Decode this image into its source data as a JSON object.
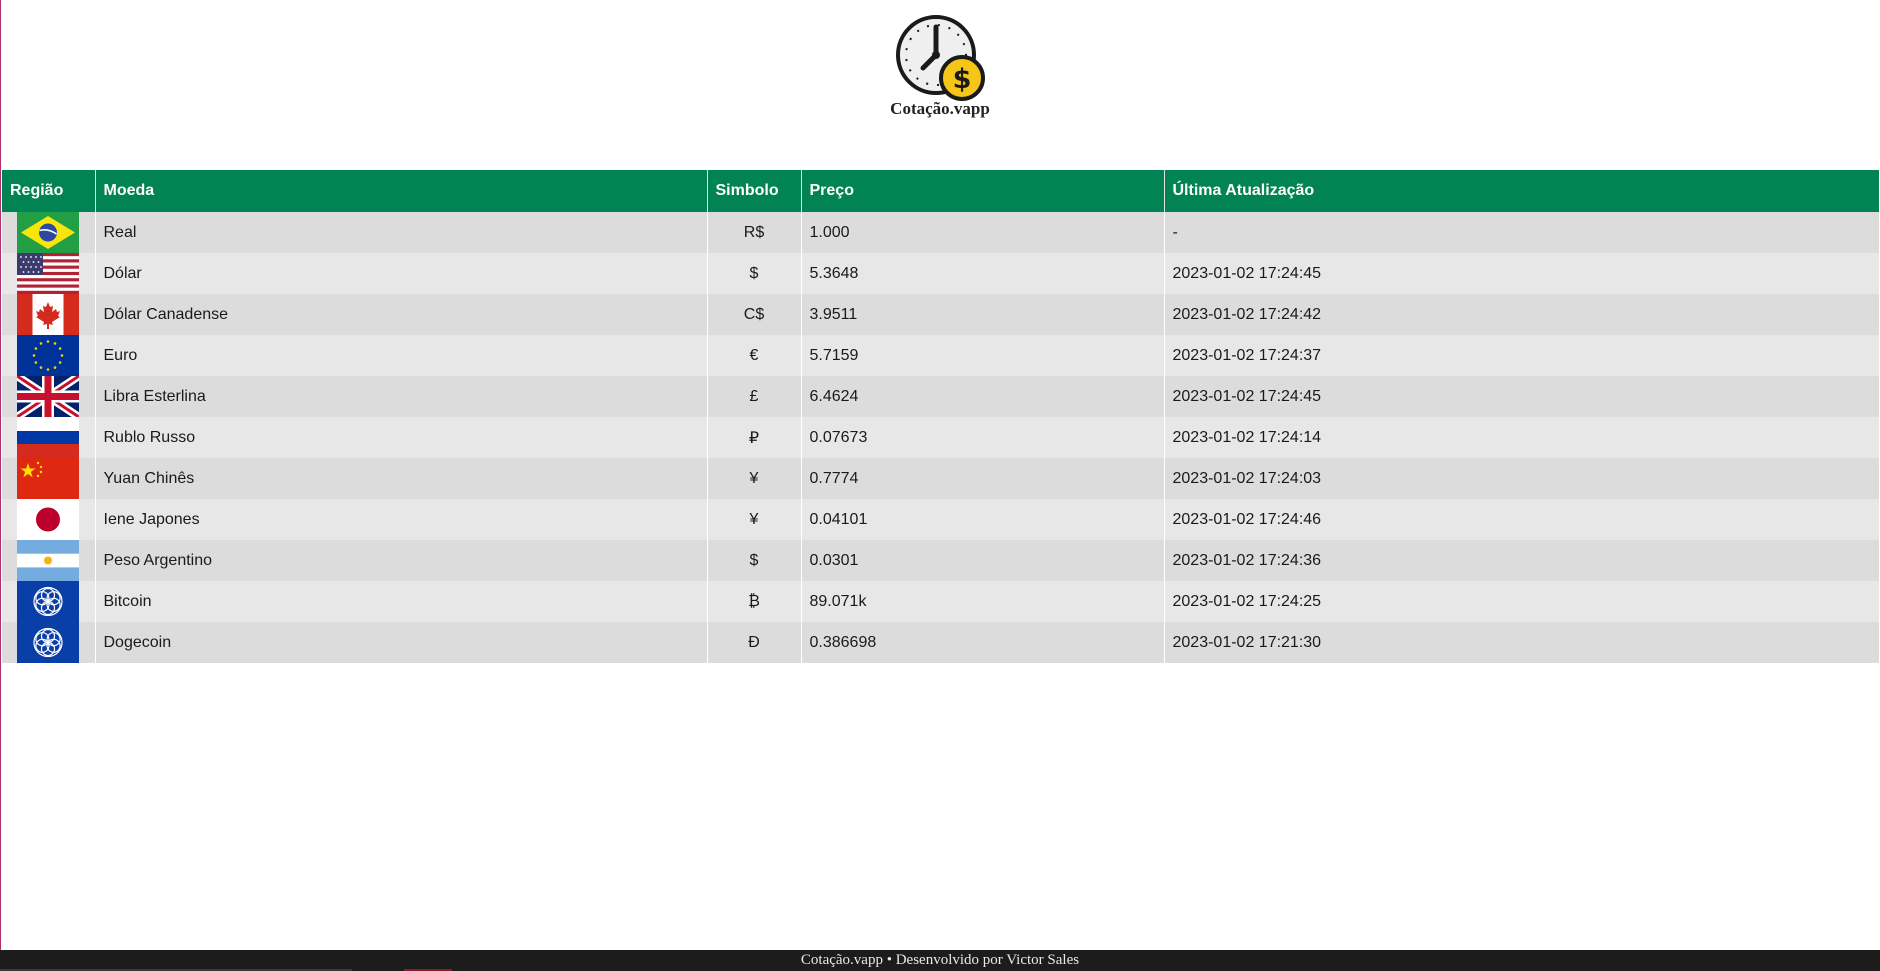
{
  "app": {
    "name": "Cotação.vapp"
  },
  "table": {
    "headers": {
      "region": "Região",
      "currency": "Moeda",
      "symbol": "Simbolo",
      "price": "Preço",
      "updated": "Última Atualização"
    },
    "rows": [
      {
        "flag": "brazil-flag-icon",
        "currency": "Real",
        "symbol": "R$",
        "price": "1.000",
        "updated": "-"
      },
      {
        "flag": "usa-flag-icon",
        "currency": "Dólar",
        "symbol": "$",
        "price": "5.3648",
        "updated": "2023-01-02 17:24:45"
      },
      {
        "flag": "canada-flag-icon",
        "currency": "Dólar Canadense",
        "symbol": "C$",
        "price": "3.9511",
        "updated": "2023-01-02 17:24:42"
      },
      {
        "flag": "eu-flag-icon",
        "currency": "Euro",
        "symbol": "€",
        "price": "5.7159",
        "updated": "2023-01-02 17:24:37"
      },
      {
        "flag": "uk-flag-icon",
        "currency": "Libra Esterlina",
        "symbol": "£",
        "price": "6.4624",
        "updated": "2023-01-02 17:24:45"
      },
      {
        "flag": "russia-flag-icon",
        "currency": "Rublo Russo",
        "symbol": "₽",
        "price": "0.07673",
        "updated": "2023-01-02 17:24:14"
      },
      {
        "flag": "china-flag-icon",
        "currency": "Yuan Chinês",
        "symbol": "¥",
        "price": "0.7774",
        "updated": "2023-01-02 17:24:03"
      },
      {
        "flag": "japan-flag-icon",
        "currency": "Iene Japones",
        "symbol": "¥",
        "price": "0.04101",
        "updated": "2023-01-02 17:24:46"
      },
      {
        "flag": "argentina-flag-icon",
        "currency": "Peso Argentino",
        "symbol": "$",
        "price": "0.0301",
        "updated": "2023-01-02 17:24:36"
      },
      {
        "flag": "crypto-emblem-icon",
        "currency": "Bitcoin",
        "symbol": "₿",
        "price": "89.071k",
        "updated": "2023-01-02 17:24:25"
      },
      {
        "flag": "crypto-emblem-icon",
        "currency": "Dogecoin",
        "symbol": "Ð",
        "price": "0.386698",
        "updated": "2023-01-02 17:21:30"
      }
    ]
  },
  "footer": {
    "text": "Cotação.vapp • Desenvolvido por Victor Sales"
  },
  "colors": {
    "header_green": "#028353",
    "row_dark": "#dcdcdc",
    "row_light": "#e7e7e7",
    "footer_bg": "#1c1c1c",
    "logo_coin": "#f5c518"
  }
}
